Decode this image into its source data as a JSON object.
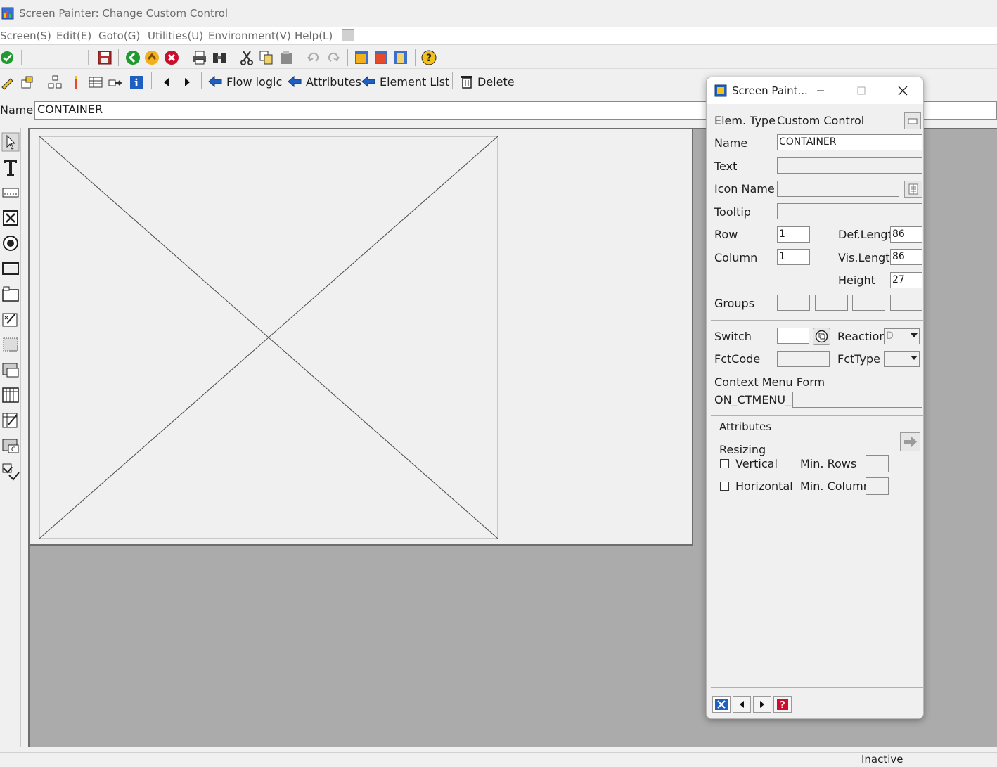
{
  "window": {
    "title": "Screen Painter:  Change Custom Control"
  },
  "menu": [
    {
      "label": "Screen(S)"
    },
    {
      "label": "Edit(E)"
    },
    {
      "label": "Goto(G)"
    },
    {
      "label": "Utilities(U)"
    },
    {
      "label": "Environment(V)"
    },
    {
      "label": "Help(L)"
    }
  ],
  "toolbar2": {
    "flow_logic": "Flow logic",
    "attributes": "Attributes",
    "element_list": "Element List",
    "delete": "Delete"
  },
  "name_row": {
    "label": "Name",
    "value": "CONTAINER"
  },
  "status": {
    "text": "Inactive"
  },
  "attr_window": {
    "title": "Screen Paint...",
    "elem_type_label": "Elem. Type",
    "elem_type_value": "Custom Control",
    "name_label": "Name",
    "name_value": "CONTAINER",
    "text_label": "Text",
    "text_value": "",
    "icon_name_label": "Icon Name",
    "icon_name_value": "",
    "tooltip_label": "Tooltip",
    "tooltip_value": "",
    "row_label": "Row",
    "row_value": "1",
    "column_label": "Column",
    "column_value": "1",
    "def_length_label": "Def.Lengtl",
    "def_length_value": "86",
    "vis_length_label": "Vis.Lengtl",
    "vis_length_value": "86",
    "height_label": "Height",
    "height_value": "27",
    "groups_label": "Groups",
    "switch_label": "Switch",
    "reaction_label": "Reaction",
    "reaction_value": "D",
    "fctcode_label": "FctCode",
    "fcttype_label": "FctType",
    "context_menu_label": "Context Menu Form",
    "on_ctmenu_label": "ON_CTMENU_",
    "on_ctmenu_value": "",
    "attributes_group_label": "Attributes",
    "resizing_label": "Resizing",
    "vertical_label": "Vertical",
    "horizontal_label": "Horizontal",
    "min_rows_label": "Min. Rows",
    "min_columns_label": "Min. Columr",
    "min_rows_value": "",
    "min_columns_value": "",
    "vertical_checked": false,
    "horizontal_checked": false
  },
  "colors": {
    "editor_gray": "#ababab",
    "canvas": "#f0f0f0",
    "arrow_blue": "#1f5fbf",
    "ok_green": "#1f9a2e",
    "cancel_red": "#c8102e"
  }
}
